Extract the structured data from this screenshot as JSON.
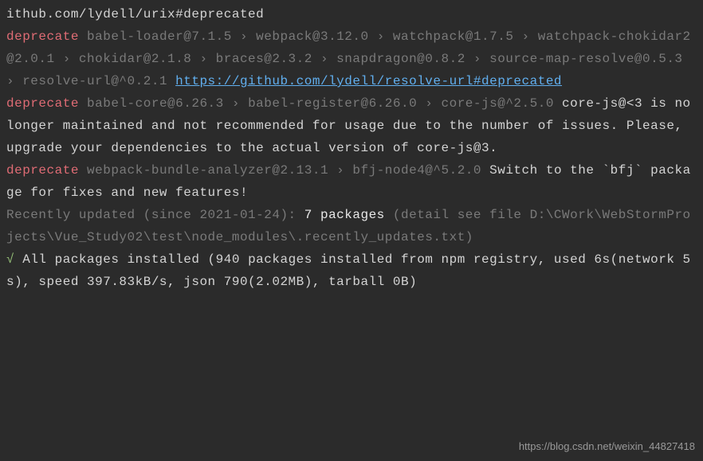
{
  "line0_tail": "ithub.com/lydell/urix#deprecated",
  "deprecate_label": "deprecate",
  "entry1": {
    "chain": "babel-loader@7.1.5 › webpack@3.12.0 › watchpack@1.7.5 › watchpack-chokidar2@2.0.1 › chokidar@2.1.8 › braces@2.3.2 › snapdragon@0.8.2 › source-map-resolve@0.5.3 › resolve-url@^0.2.1",
    "link": "https://github.com/lydell/resolve-url#deprecated"
  },
  "entry2": {
    "chain": "babel-core@6.26.3 › babel-register@6.26.0 › core-js@^2.5.0",
    "message": " core-js@<3 is no longer maintained and not recommended for usage due to the number of issues. Please, upgrade your dependencies to the actual version of core-js@3."
  },
  "entry3": {
    "chain": "webpack-bundle-analyzer@2.13.1 › bfj-node4@^5.2.0",
    "message": "Switch to the `bfj` package for fixes and new features!"
  },
  "recent": {
    "prefix": "Recently updated (since 2021-01-24):",
    "count": "7 packages",
    "detail": "(detail see file D:\\CWork\\WebStormProjects\\Vue_Study02\\test\\node_modules\\.recently_updates.txt)"
  },
  "checkmark": "√",
  "summary": "All packages installed (940 packages installed from npm registry, used 6s(network 5s), speed 397.83kB/s, json 790(2.02MB), tarball 0B)",
  "watermark": "https://blog.csdn.net/weixin_44827418"
}
